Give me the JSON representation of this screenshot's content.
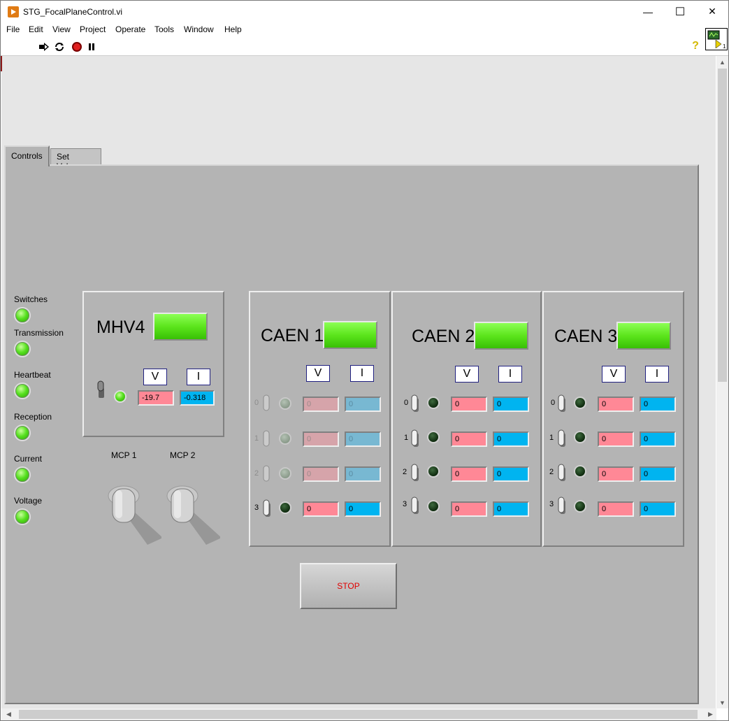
{
  "window": {
    "title": "STG_FocalPlaneControl.vi",
    "controls": {
      "minimize": "—",
      "maximize": "☐",
      "close": "✕"
    }
  },
  "menu": [
    "File",
    "Edit",
    "View",
    "Project",
    "Operate",
    "Tools",
    "Window",
    "Help"
  ],
  "toolbar": {
    "icons": [
      "run-icon",
      "run-continuously-icon",
      "abort-icon",
      "pause-icon"
    ],
    "help": "?"
  },
  "tabs": [
    {
      "label": "Controls",
      "selected": true
    },
    {
      "label": "Set Values",
      "selected": false
    }
  ],
  "status_indicators": [
    {
      "label": "Switches",
      "on": true
    },
    {
      "label": "Transmission",
      "on": true
    },
    {
      "label": "Heartbeat",
      "on": true
    },
    {
      "label": "Reception",
      "on": true
    },
    {
      "label": "Current",
      "on": true
    },
    {
      "label": "Voltage",
      "on": true
    }
  ],
  "mhv4": {
    "title": "MHV4",
    "v_header": "V",
    "i_header": "I",
    "voltage": "-19.7",
    "current": "-0.318"
  },
  "mcp": {
    "labels": [
      "MCP 1",
      "MCP 2"
    ]
  },
  "caen": [
    {
      "title": "CAEN 1",
      "v_header": "V",
      "i_header": "I",
      "channels": [
        {
          "label": "0",
          "v": "0",
          "i": "0",
          "enabled": false
        },
        {
          "label": "1",
          "v": "0",
          "i": "0",
          "enabled": false
        },
        {
          "label": "2",
          "v": "0",
          "i": "0",
          "enabled": false
        },
        {
          "label": "3",
          "v": "0",
          "i": "0",
          "enabled": true
        }
      ]
    },
    {
      "title": "CAEN 2",
      "v_header": "V",
      "i_header": "I",
      "channels": [
        {
          "label": "0",
          "v": "0",
          "i": "0",
          "enabled": true
        },
        {
          "label": "1",
          "v": "0",
          "i": "0",
          "enabled": true
        },
        {
          "label": "2",
          "v": "0",
          "i": "0",
          "enabled": true
        },
        {
          "label": "3",
          "v": "0",
          "i": "0",
          "enabled": true
        }
      ]
    },
    {
      "title": "CAEN 3",
      "v_header": "V",
      "i_header": "I",
      "channels": [
        {
          "label": "0",
          "v": "0",
          "i": "0",
          "enabled": true
        },
        {
          "label": "1",
          "v": "0",
          "i": "0",
          "enabled": true
        },
        {
          "label": "2",
          "v": "0",
          "i": "0",
          "enabled": true
        },
        {
          "label": "3",
          "v": "0",
          "i": "0",
          "enabled": true
        }
      ]
    }
  ],
  "stop": {
    "label": "STOP"
  },
  "colors": {
    "led_on": "#55e01e",
    "voltage_bg": "#ff8896",
    "current_bg": "#00b4f0",
    "panel": "#b4b4b4",
    "stop_text": "#e00000"
  }
}
